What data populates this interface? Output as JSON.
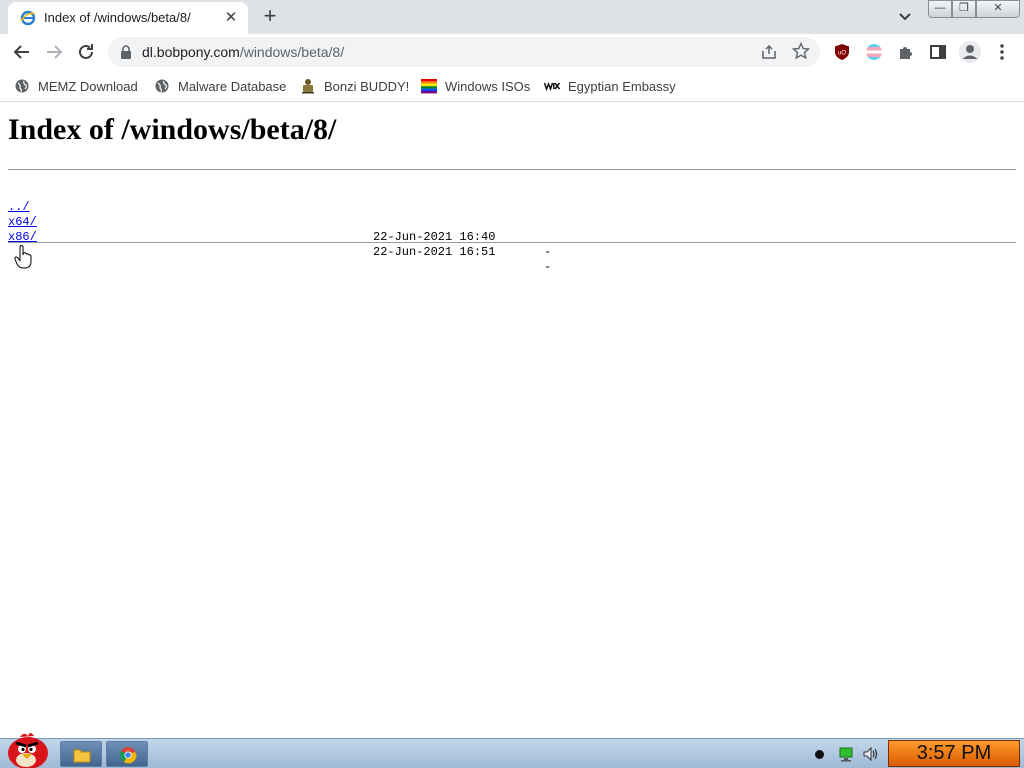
{
  "tab": {
    "title": "Index of /windows/beta/8/",
    "close_glyph": "✕",
    "new_tab_glyph": "+"
  },
  "window_controls": {
    "minimize_glyph": "—",
    "maximize_glyph": "❐",
    "close_glyph": "✕"
  },
  "toolbar": {
    "url_host": "dl.bobpony.com",
    "url_path": "/windows/beta/8/"
  },
  "bookmarks": [
    {
      "label": "MEMZ Download",
      "icon": "globe-icon"
    },
    {
      "label": "Malware Database",
      "icon": "globe-icon"
    },
    {
      "label": "Bonzi BUDDY!",
      "icon": "bonzi-icon"
    },
    {
      "label": "Windows ISOs",
      "icon": "rainbow-flag-icon"
    },
    {
      "label": "Egyptian Embassy",
      "icon": "wix-icon"
    }
  ],
  "page": {
    "heading": "Index of /windows/beta/8/",
    "entries": [
      {
        "name": "../",
        "date": "",
        "size": ""
      },
      {
        "name": "x64/",
        "date": "22-Jun-2021 16:40",
        "size": "-"
      },
      {
        "name": "x86/",
        "date": "22-Jun-2021 16:51",
        "size": "-"
      }
    ]
  },
  "taskbar": {
    "clock": "3:57 PM",
    "apps": [
      "file-explorer-icon",
      "chrome-icon"
    ]
  },
  "colors": {
    "link": "#0000ee",
    "tabstrip": "#dee1e6",
    "clock_bg": "#ff8c1a"
  }
}
